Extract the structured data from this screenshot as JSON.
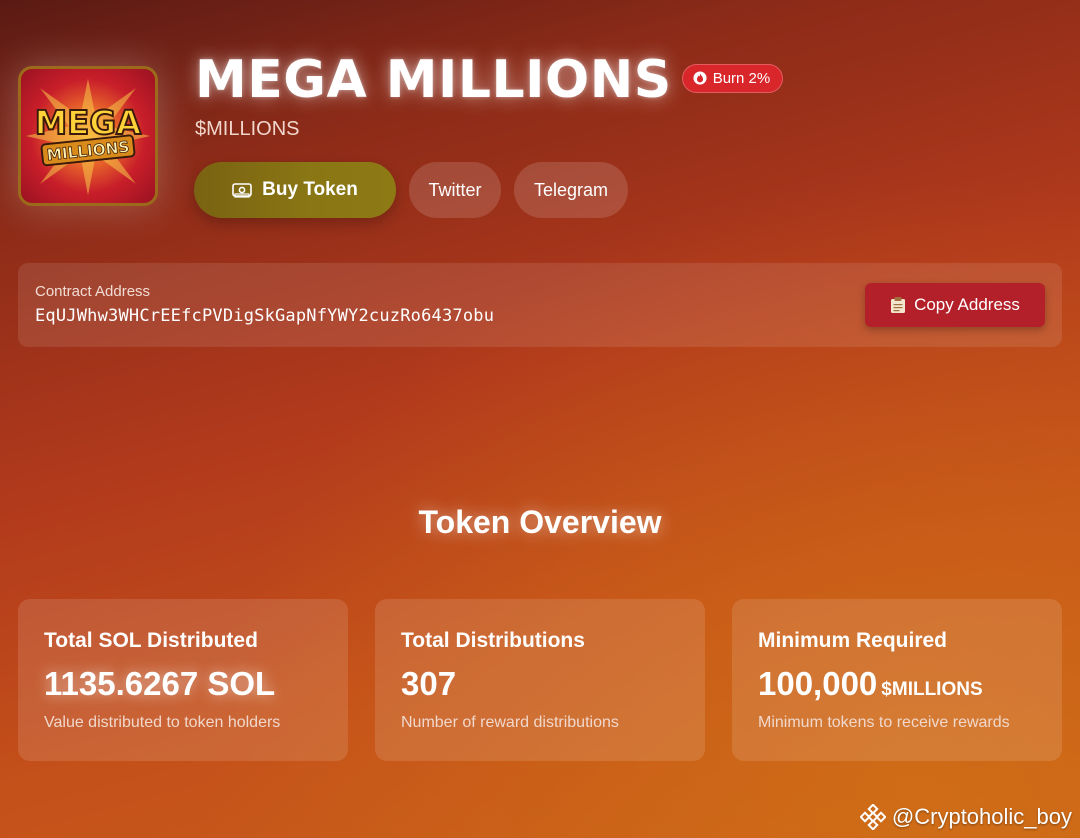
{
  "header": {
    "title": "MEGA MILLIONS",
    "burn_badge": "Burn 2%",
    "ticker": "$MILLIONS",
    "logo_text_top": "MEGA",
    "logo_text_bottom": "MILLIONS"
  },
  "buttons": {
    "buy": "Buy Token",
    "twitter": "Twitter",
    "telegram": "Telegram"
  },
  "contract": {
    "label": "Contract Address",
    "address": "EqUJWhw3WHCrEEfcPVDigSkGapNfYWY2cuzRo6437obu",
    "copy_label": "Copy Address"
  },
  "overview": {
    "title": "Token Overview",
    "cards": [
      {
        "title": "Total SOL Distributed",
        "value": "1135.6267 SOL",
        "unit": "",
        "desc": "Value distributed to token holders"
      },
      {
        "title": "Total Distributions",
        "value": "307",
        "unit": "",
        "desc": "Number of reward distributions"
      },
      {
        "title": "Minimum Required",
        "value": "100,000",
        "unit": "$MILLIONS",
        "desc": "Minimum tokens to receive rewards"
      }
    ]
  },
  "watermark": "@Cryptoholic_boy",
  "colors": {
    "burn_badge": "#d8262b",
    "buy_button": "#8a7714",
    "copy_button": "#b4202a"
  },
  "icons": {
    "burn": "flame-icon",
    "buy": "cash-icon",
    "copy": "clipboard-icon",
    "watermark": "binance-icon"
  }
}
